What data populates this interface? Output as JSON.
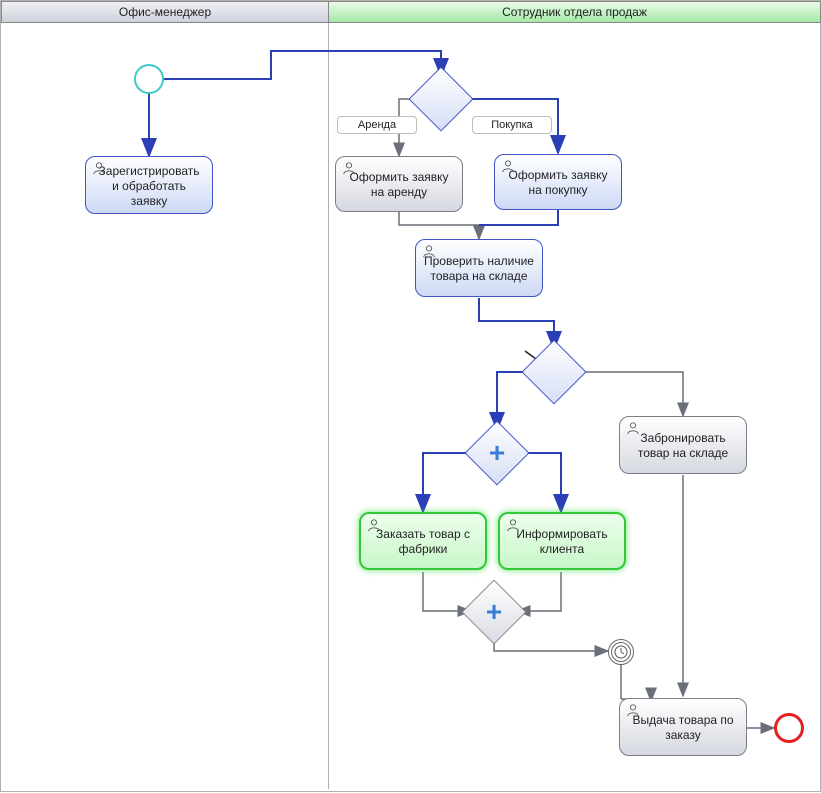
{
  "lanes": {
    "office": "Офис-менеджер",
    "sales": "Сотрудник отдела продаж"
  },
  "tasks": {
    "register": "Зарегистрировать и обработать заявку",
    "rent": "Оформить заявку на аренду",
    "purchase": "Оформить заявку на покупку",
    "stock": "Проверить наличие товара на складе",
    "order": "Заказать товар с фабрики",
    "inform": "Информировать клиента",
    "reserve": "Забронировать товар на складе",
    "delivery": "Выдача товара по заказу"
  },
  "flow_labels": {
    "rent": "Аренда",
    "purchase": "Покупка"
  },
  "colors": {
    "sequence": "#2a3fb6",
    "sequence_gray": "#6b6f79",
    "gateway_border": "#3f55c9",
    "task_green": "#32c837",
    "end_event": "#e22020"
  }
}
